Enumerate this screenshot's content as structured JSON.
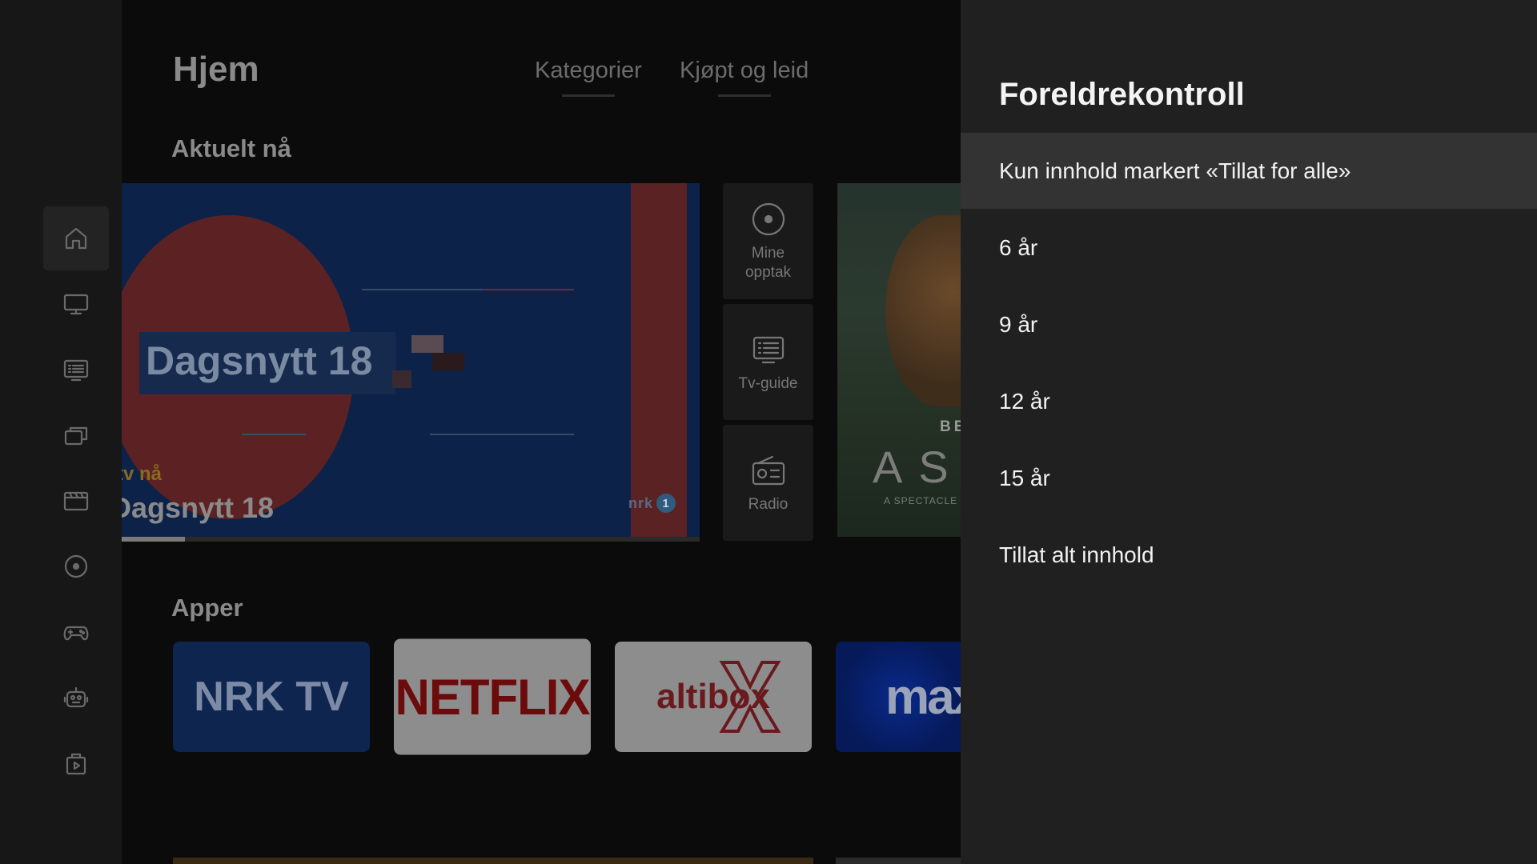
{
  "sidebar": {
    "items": [
      {
        "icon": "home-icon",
        "active": true
      },
      {
        "icon": "tv-icon",
        "active": false
      },
      {
        "icon": "tv-guide-icon",
        "active": false
      },
      {
        "icon": "library-icon",
        "active": false
      },
      {
        "icon": "movie-icon",
        "active": false
      },
      {
        "icon": "recording-icon",
        "active": false
      },
      {
        "icon": "gamepad-icon",
        "active": false
      },
      {
        "icon": "robot-icon",
        "active": false
      },
      {
        "icon": "play-bag-icon",
        "active": false
      }
    ]
  },
  "header": {
    "title": "Hjem",
    "tabs": [
      {
        "label": "Kategorier"
      },
      {
        "label": "Kjøpt og leid"
      }
    ]
  },
  "current": {
    "section_title": "Aktuelt nå",
    "featured": {
      "banner_text": "Dagsnytt 18",
      "live_label": "tv nå",
      "program_title": "Dagsnytt 18",
      "channel": "nrk",
      "channel_number": "1",
      "progress": 0.11
    },
    "shortcuts": [
      {
        "label": "Mine\nopptak",
        "icon": "recording-icon"
      },
      {
        "label": "Tv-guide",
        "icon": "tv-guide-icon"
      },
      {
        "label": "Radio",
        "icon": "radio-icon"
      }
    ],
    "promo": {
      "brand": "BBC",
      "title": "AS",
      "tagline": "A SPECTACLE L"
    }
  },
  "apps": {
    "section_title": "Apper",
    "items": [
      {
        "label": "NRK TV"
      },
      {
        "label": "NETFLIX"
      },
      {
        "label": "altibox"
      },
      {
        "label": "max"
      }
    ]
  },
  "parental_control": {
    "title": "Foreldrekontroll",
    "options": [
      {
        "label": "Kun innhold markert «Tillat for alle»",
        "selected": true
      },
      {
        "label": "6 år",
        "selected": false
      },
      {
        "label": "9 år",
        "selected": false
      },
      {
        "label": "12 år",
        "selected": false
      },
      {
        "label": "15 år",
        "selected": false
      },
      {
        "label": "Tillat alt innhold",
        "selected": false
      }
    ]
  },
  "colors": {
    "panel_bg": "#202020",
    "selected_bg": "#333333",
    "nrk_blue": "#0e2550",
    "netflix_red": "#6b0b0b"
  }
}
